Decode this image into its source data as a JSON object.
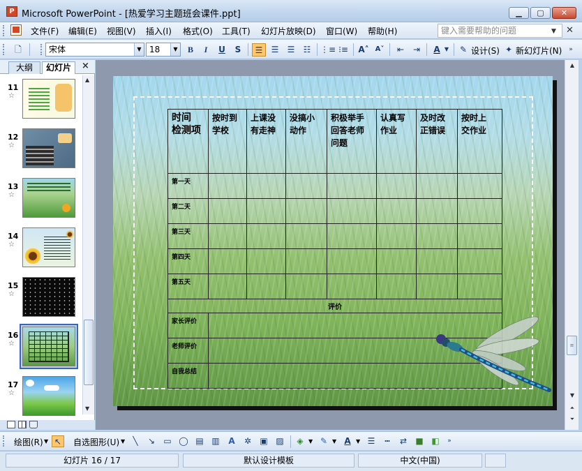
{
  "window": {
    "title": "Microsoft PowerPoint - [热爱学习主题班会课件.ppt]",
    "minimize_icon": "minimize-icon",
    "maximize_icon": "maximize-icon",
    "close_icon": "close-icon"
  },
  "menu": {
    "items": [
      "文件(F)",
      "编辑(E)",
      "视图(V)",
      "插入(I)",
      "格式(O)",
      "工具(T)",
      "幻灯片放映(D)",
      "窗口(W)",
      "帮助(H)"
    ],
    "help_placeholder": "键入需要帮助的问题"
  },
  "toolbar": {
    "font_name": "宋体",
    "font_size": "18",
    "bold": "B",
    "italic": "I",
    "underline": "U",
    "shadow": "S",
    "design_label": "设计(S)",
    "new_slide_label": "新幻灯片(N)"
  },
  "left_panel": {
    "tab_outline": "大纲",
    "tab_slides": "幻灯片",
    "close": "×",
    "thumbnails": [
      {
        "number": "11"
      },
      {
        "number": "12"
      },
      {
        "number": "13"
      },
      {
        "number": "14"
      },
      {
        "number": "15"
      },
      {
        "number": "16",
        "selected": true
      },
      {
        "number": "17"
      }
    ]
  },
  "slide": {
    "header": [
      "时间\n检测项",
      "按时到\n学校",
      "上课没\n有走神",
      "没搞小\n动作",
      "积极举手\n回答老师\n问题",
      "认真写\n作业",
      "及时改\n正错误",
      "按时上\n交作业"
    ],
    "days": [
      "第一天",
      "第二天",
      "第三天",
      "第四天",
      "第五天"
    ],
    "evaluation_title": "评价",
    "evaluations": [
      "家长评价",
      "老师评价",
      "自我总结"
    ]
  },
  "drawbar": {
    "draw_label": "绘图(R)",
    "autoshapes_label": "自选图形(U)"
  },
  "status": {
    "slide_position": "幻灯片 16 / 17",
    "template": "默认设计模板",
    "language": "中文(中国)"
  },
  "colors": {
    "titlebar": "#c4d8ee",
    "selection_border": "#3a66b5",
    "active_button": "#ffc66d"
  }
}
